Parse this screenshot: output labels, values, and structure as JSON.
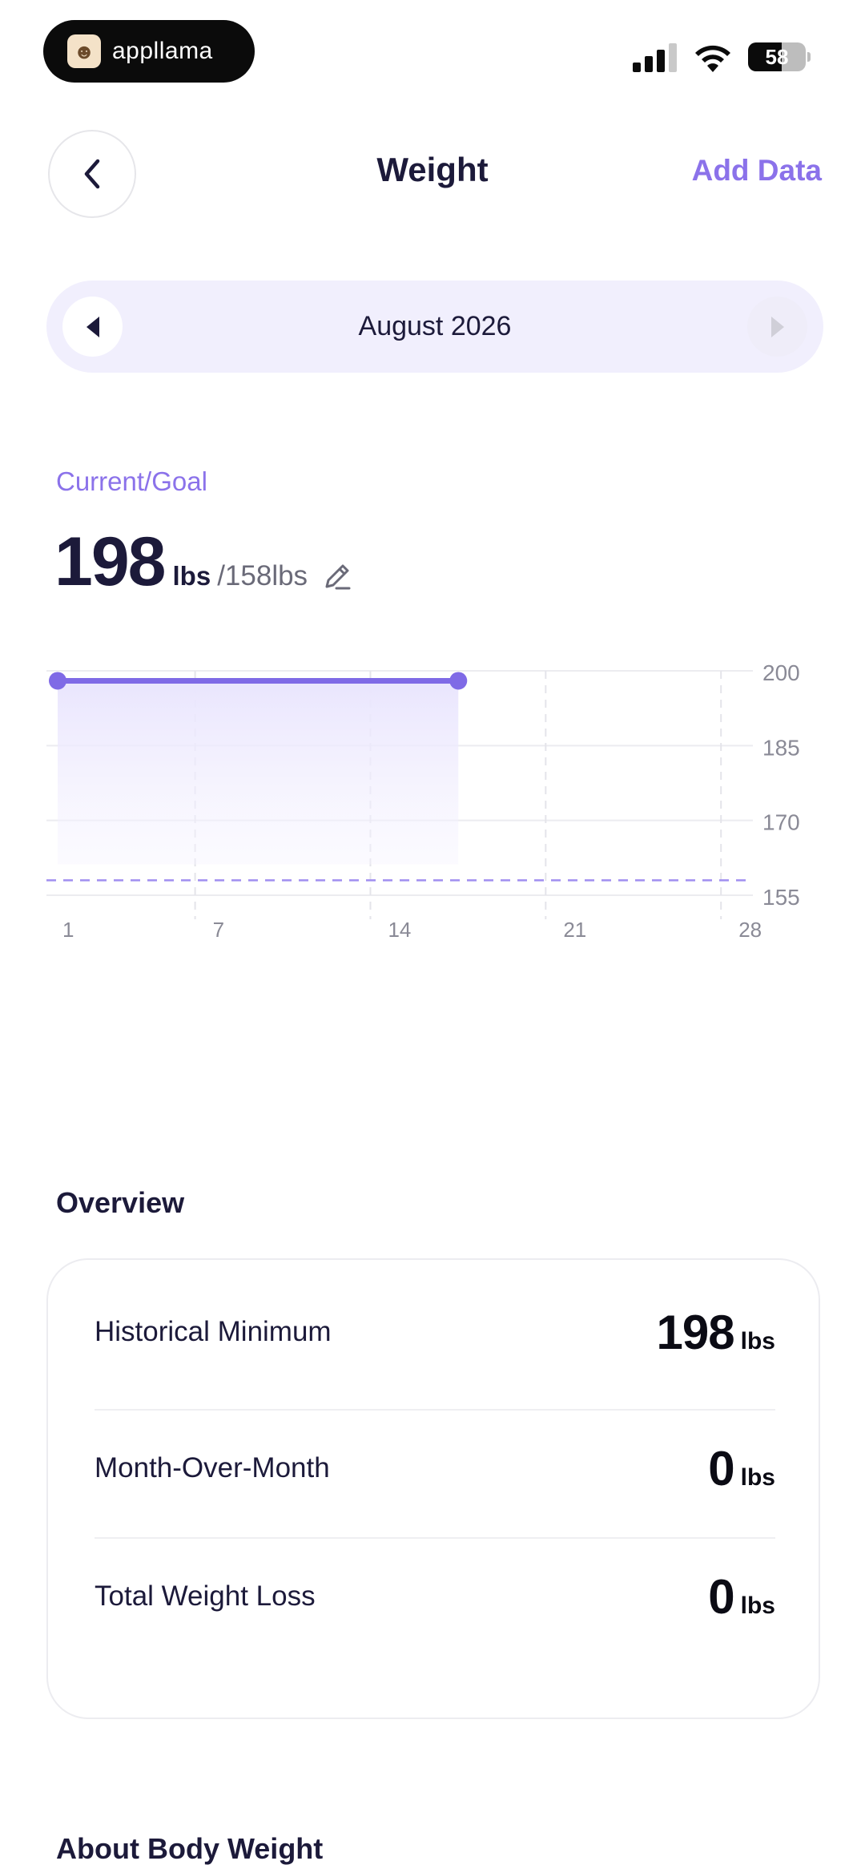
{
  "status_bar": {
    "app_name": "appllama",
    "battery_level": 58,
    "battery_text": "58",
    "icons": [
      "signal-icon",
      "wifi-icon",
      "battery-icon"
    ]
  },
  "header": {
    "title": "Weight",
    "add_data_label": "Add Data",
    "back_icon": "chevron-left-icon"
  },
  "month_selector": {
    "label": "August 2026",
    "prev_icon": "triangle-left-icon",
    "next_icon": "triangle-right-icon"
  },
  "summary": {
    "label": "Current/Goal",
    "current_value": "198",
    "current_unit": "lbs",
    "separator": "/",
    "goal_value": "158lbs",
    "edit_icon": "pencil-icon"
  },
  "colors": {
    "accent": "#8b72ea",
    "line": "#7f6ae6",
    "text": "#1c1a3a"
  },
  "chart_data": {
    "type": "line",
    "x": [
      1,
      17
    ],
    "values": [
      198,
      198
    ],
    "xticks": [
      "1",
      "7",
      "14",
      "21",
      "28"
    ],
    "xtick_values": [
      1,
      7,
      14,
      21,
      28
    ],
    "yticks": [
      "200",
      "185",
      "170",
      "155"
    ],
    "ytick_values": [
      200,
      185,
      170,
      155
    ],
    "xlim": [
      1,
      31
    ],
    "ylim": [
      155,
      200
    ],
    "goal_line": 158,
    "grid": true,
    "area_fill": true
  },
  "overview": {
    "title": "Overview",
    "rows": [
      {
        "label": "Historical Minimum",
        "value": "198",
        "unit": "lbs"
      },
      {
        "label": "Month-Over-Month",
        "value": "0",
        "unit": "lbs"
      },
      {
        "label": "Total Weight Loss",
        "value": "0",
        "unit": "lbs"
      }
    ]
  },
  "about": {
    "title": "About Body Weight"
  }
}
